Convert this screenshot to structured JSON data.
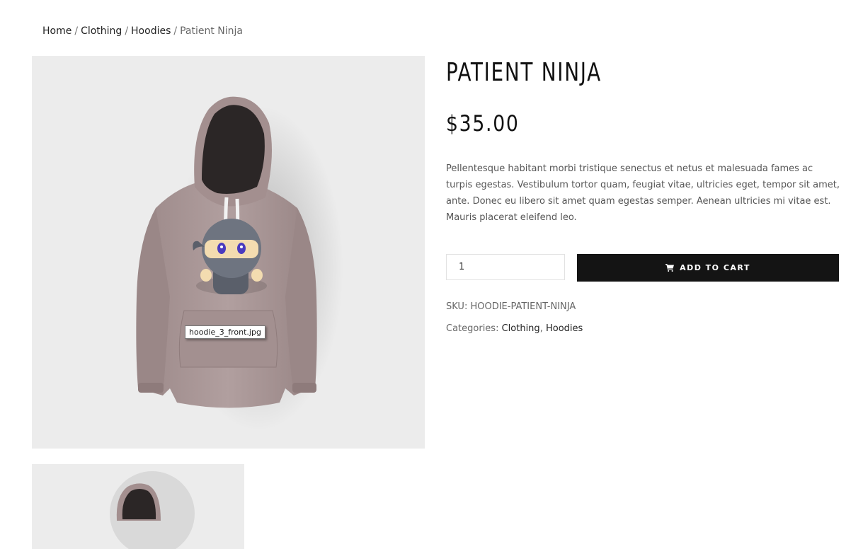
{
  "breadcrumb": {
    "home": "Home",
    "clothing": "Clothing",
    "hoodies": "Hoodies",
    "current": "Patient Ninja",
    "separator": "/"
  },
  "product": {
    "title": "PATIENT NINJA",
    "price": "$35.00",
    "description": "Pellentesque habitant morbi tristique senectus et netus et malesuada fames ac turpis egestas. Vestibulum tortor quam, feugiat vitae, ultricies eget, tempor sit amet, ante. Donec eu libero sit amet quam egestas semper. Aenean ultricies mi vitae est. Mauris placerat eleifend leo.",
    "quantity": "1",
    "add_to_cart_label": "ADD TO CART",
    "sku_label": "SKU:",
    "sku_value": "HOODIE-PATIENT-NINJA",
    "categories_label": "Categories:",
    "categories": [
      "Clothing",
      "Hoodies"
    ],
    "categories_separator": ","
  },
  "gallery": {
    "tooltip": "hoodie_3_front.jpg"
  },
  "colors": {
    "button_bg": "#141414",
    "image_bg": "#ececec",
    "hoodie": "#a89595"
  }
}
